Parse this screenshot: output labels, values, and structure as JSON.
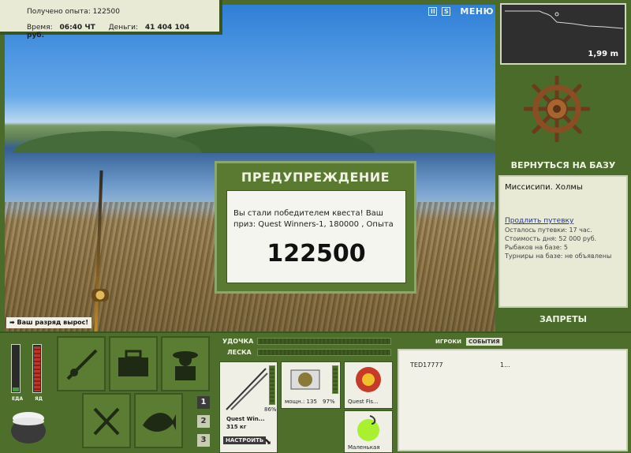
{
  "info": {
    "xp_label": "Получено опыта:",
    "xp_value": "122500",
    "time_label": "Время:",
    "time_value": "06:40 ЧТ",
    "money_label": "Деньги:",
    "money_value": "41 404 104 руб."
  },
  "top_icons": {
    "pause": "II",
    "sound": "S",
    "menu": "МЕНЮ"
  },
  "depth": {
    "value": "1,99 m"
  },
  "right": {
    "back_to_base": "ВЕРНУТЬСЯ НА БАЗУ",
    "location_title": "Миссисипи. Холмы",
    "extend_link": "Продлить путевку",
    "trip_left": "Осталось путевки: 17 час.",
    "day_cost": "Стоимость дня: 52 000 руб.",
    "fishers": "Рыбаков на базе: 5",
    "tournaments": "Турниры на базе: не объявлены",
    "bans": "ЗАПРЕТЫ"
  },
  "warning": {
    "title": "ПРЕДУПРЕЖДЕНИЕ",
    "message": "Вы стали победителем квеста! Ваш приз: Quest Winners-1, 180000 , Опыта",
    "number": "122500"
  },
  "rank_message": "Ваш разряд вырос!",
  "status_bars": {
    "food_label": "ЕДА",
    "poison_label": "ЯД",
    "food_level": 0.08,
    "poison_level": 0.95
  },
  "page_buttons": [
    "1",
    "2",
    "3"
  ],
  "gear": {
    "rod_label": "УДОЧКА",
    "line_label": "ЛЕСКА",
    "rod_name": "Quest Win...",
    "rod_weight": "315 кг",
    "rod_percent": "86%",
    "setup": "НАСТРОИТЬ",
    "reel_power": "мощн.: 135",
    "reel_percent": "97%",
    "line_name": "Quest Fis...",
    "lure_name": "Маленькая"
  },
  "tabs": {
    "players": "ИГРОКИ",
    "events": "СОБЫТИЯ"
  },
  "players_list": [
    {
      "name": "TED17777",
      "value": "1..."
    }
  ],
  "colors": {
    "panel_green": "#4a6b2a",
    "panel_light": "#e8ead6",
    "accent_red": "#c0342a"
  }
}
